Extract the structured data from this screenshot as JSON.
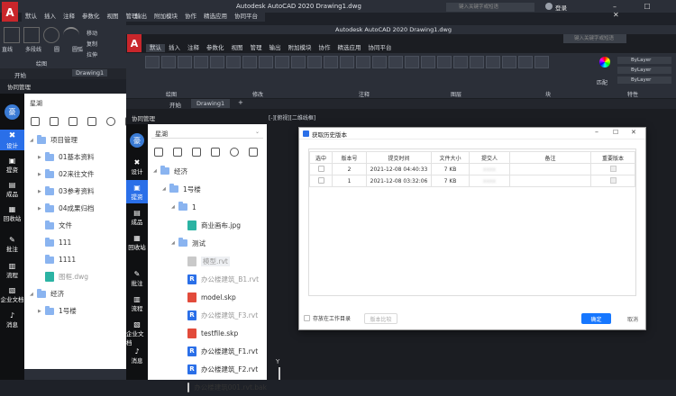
{
  "back_window": {
    "title": "Autodesk AutoCAD 2020   Drawing1.dwg",
    "search_placeholder": "键入关键字或短语",
    "login": "登录",
    "menu": [
      "默认",
      "插入",
      "注释",
      "参数化",
      "视图",
      "管理",
      "输出",
      "附加模块",
      "协作",
      "精选应用",
      "协同平台"
    ],
    "tools": [
      "直线",
      "多段线",
      "圆",
      "圆弧"
    ],
    "tool_labels": [
      "移动",
      "复制",
      "拉伸"
    ],
    "section": "绘图",
    "tabs": [
      "开始",
      "Drawing1"
    ],
    "panel_title": "协同管理"
  },
  "front_window": {
    "title": "Autodesk AutoCAD 2020   Drawing1.dwg",
    "search_placeholder": "键入关键字或短语",
    "menu": [
      "默认",
      "插入",
      "注释",
      "参数化",
      "视图",
      "管理",
      "输出",
      "附加模块",
      "协作",
      "精选应用",
      "协同平台"
    ],
    "ribbon_sections": [
      "绘图",
      "修改",
      "注释",
      "图层",
      "块",
      "特性"
    ],
    "layer_text": "ByLayer",
    "match_label": "匹配",
    "tabs": [
      "开始",
      "Drawing1"
    ],
    "viewport_label": "[-][俯视][二维线框]",
    "panel_title": "协同管理",
    "axis_label": "Y"
  },
  "left_sidebar": {
    "avatar": "豪",
    "items": [
      "设计",
      "提资",
      "成品",
      "回收站",
      "批注",
      "流程",
      "企业文档",
      "消息"
    ]
  },
  "back_tree": {
    "project": "星湖",
    "rows": [
      "项目管理",
      "01基本资料",
      "02来往文件",
      "03参考资料",
      "04成果归档",
      "文件",
      "111",
      "1111",
      "图框.dwg",
      "经济",
      "1号楼"
    ]
  },
  "front_tree": {
    "project": "星湖",
    "rows": [
      "经济",
      "1号楼",
      "1",
      "商业画布.jpg",
      "测试",
      "模型.rvt",
      "办公楼建筑_B1.rvt",
      "model.skp",
      "办公楼建筑_F3.rvt",
      "testfile.skp",
      "办公楼建筑_F1.rvt",
      "办公楼建筑_F2.rvt",
      "办公楼建筑001.rvt.bak"
    ]
  },
  "dialog": {
    "title": "获取历史版本",
    "columns": [
      "选中",
      "版本号",
      "提交时间",
      "文件大小",
      "提交人",
      "备注",
      "重要版本"
    ],
    "rows": [
      {
        "version": "2",
        "time": "2021-12-08 04:40:33",
        "size": "7 KB",
        "user": "xxxx",
        "note": ""
      },
      {
        "version": "1",
        "time": "2021-12-08 03:32:06",
        "size": "7 KB",
        "user": "xxxx",
        "note": ""
      }
    ],
    "save_label": "存放在工作目录",
    "compare_label": "版本比较",
    "ok_label": "确定",
    "cancel_label": "取消"
  },
  "colors": {
    "accent": "#1677ff",
    "dark_bg": "#1e2128",
    "panel": "#2b2f38"
  }
}
